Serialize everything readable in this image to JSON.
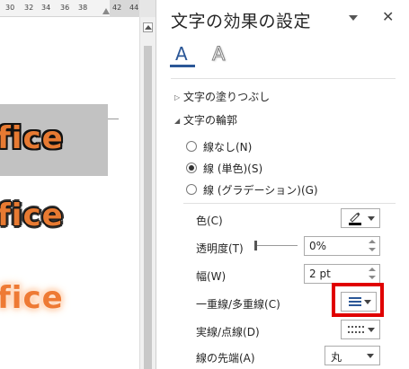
{
  "ruler": {
    "ticks": [
      "30",
      "32",
      "34",
      "36",
      "38",
      "42",
      "44"
    ]
  },
  "document": {
    "words": [
      "fice",
      "fice",
      "fice"
    ]
  },
  "pane": {
    "title": "文字の効果の設定",
    "tabs": [
      {
        "name": "文字の塗りつぶしと輪郭",
        "glyph": "A",
        "selected": true
      },
      {
        "name": "文字の効果",
        "glyph": "A",
        "selected": false
      }
    ],
    "sections": {
      "fill": {
        "label": "文字の塗りつぶし",
        "expanded": false
      },
      "outline": {
        "label": "文字の輪郭",
        "expanded": true
      }
    },
    "outline_options": [
      {
        "label": "線なし(N)",
        "selected": false
      },
      {
        "label": "線 (単色)(S)",
        "selected": true
      },
      {
        "label": "線 (グラデーション)(G)",
        "selected": false
      }
    ],
    "properties": {
      "color_label": "色(C)",
      "transparency_label": "透明度(T)",
      "transparency_value": "0%",
      "transparency_level": 0,
      "width_label": "幅(W)",
      "width_value": "2 pt",
      "compound_label": "一重線/多重線(C)",
      "dash_label": "実線/点線(D)",
      "cap_label": "線の先端(A)",
      "cap_value": "丸"
    },
    "colors": {
      "accent": "#2b5797",
      "highlight": "#e00000",
      "text_orange": "#e77a32"
    }
  }
}
